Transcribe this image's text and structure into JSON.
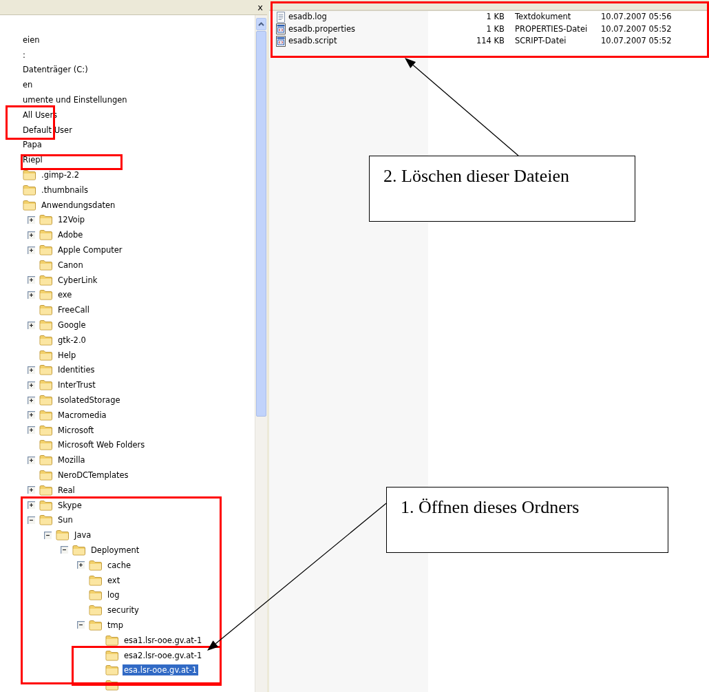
{
  "folder_pane": {
    "close": "x",
    "tree": [
      {
        "label": "eien",
        "kind": "clipped"
      },
      {
        "label": ":",
        "kind": "clipped"
      },
      {
        "label": "Datenträger (C:)",
        "kind": "clipped",
        "children": [
          {
            "label": "en",
            "kind": "clipped"
          },
          {
            "label": "umente und Einstellungen",
            "kind": "clipped",
            "children": [
              {
                "label": "All Users",
                "kind": "clipped"
              },
              {
                "label": "Default User",
                "kind": "clipped"
              },
              {
                "label": "Papa",
                "kind": "clipped"
              },
              {
                "label": "Riepl",
                "kind": "clipped",
                "children": [
                  {
                    "label": ".gimp-2.2",
                    "kind": "folder"
                  },
                  {
                    "label": ".thumbnails",
                    "kind": "folder"
                  },
                  {
                    "label": "Anwendungsdaten",
                    "kind": "folder",
                    "children": [
                      {
                        "label": "12Voip",
                        "kind": "folder",
                        "expanded": false
                      },
                      {
                        "label": "Adobe",
                        "kind": "folder",
                        "expanded": false
                      },
                      {
                        "label": "Apple Computer",
                        "kind": "folder",
                        "expanded": false
                      },
                      {
                        "label": "Canon",
                        "kind": "folder"
                      },
                      {
                        "label": "CyberLink",
                        "kind": "folder",
                        "expanded": false
                      },
                      {
                        "label": "exe",
                        "kind": "folder",
                        "expanded": false
                      },
                      {
                        "label": "FreeCall",
                        "kind": "folder"
                      },
                      {
                        "label": "Google",
                        "kind": "folder",
                        "expanded": false
                      },
                      {
                        "label": "gtk-2.0",
                        "kind": "folder"
                      },
                      {
                        "label": "Help",
                        "kind": "folder"
                      },
                      {
                        "label": "Identities",
                        "kind": "folder",
                        "expanded": false
                      },
                      {
                        "label": "InterTrust",
                        "kind": "folder",
                        "expanded": false
                      },
                      {
                        "label": "IsolatedStorage",
                        "kind": "folder",
                        "expanded": false
                      },
                      {
                        "label": "Macromedia",
                        "kind": "folder",
                        "expanded": false
                      },
                      {
                        "label": "Microsoft",
                        "kind": "folder",
                        "expanded": false
                      },
                      {
                        "label": "Microsoft Web Folders",
                        "kind": "folder"
                      },
                      {
                        "label": "Mozilla",
                        "kind": "folder",
                        "expanded": false
                      },
                      {
                        "label": "NeroDCTemplates",
                        "kind": "folder"
                      },
                      {
                        "label": "Real",
                        "kind": "folder",
                        "expanded": false
                      },
                      {
                        "label": "Skype",
                        "kind": "folder",
                        "expanded": false
                      },
                      {
                        "label": "Sun",
                        "kind": "folder",
                        "expanded": true,
                        "children": [
                          {
                            "label": "Java",
                            "kind": "folder",
                            "expanded": true,
                            "children": [
                              {
                                "label": "Deployment",
                                "kind": "folder",
                                "expanded": true,
                                "children": [
                                  {
                                    "label": "cache",
                                    "kind": "folder",
                                    "expanded": false
                                  },
                                  {
                                    "label": "ext",
                                    "kind": "folder"
                                  },
                                  {
                                    "label": "log",
                                    "kind": "folder"
                                  },
                                  {
                                    "label": "security",
                                    "kind": "folder"
                                  },
                                  {
                                    "label": "tmp",
                                    "kind": "folder",
                                    "expanded": true,
                                    "children": [
                                      {
                                        "label": "esa1.lsr-ooe.gv.at-1",
                                        "kind": "folder",
                                        "selected": false
                                      },
                                      {
                                        "label": "esa2.lsr-ooe.gv.at-1",
                                        "kind": "folder",
                                        "selected": false
                                      },
                                      {
                                        "label": "esa.lsr-ooe.gv.at-1",
                                        "kind": "folder",
                                        "selected": true
                                      },
                                      {
                                        "kind": "folder"
                                      }
                                    ]
                                  }
                                ]
                              }
                            ]
                          }
                        ]
                      }
                    ]
                  }
                ]
              }
            ]
          }
        ]
      }
    ]
  },
  "file_list": {
    "rows": [
      {
        "name": "esadb.log",
        "kind": "text",
        "size": "1 KB",
        "type": "Textdokument",
        "modified": "10.07.2007 05:56"
      },
      {
        "name": "esadb.properties",
        "kind": "script",
        "size": "1 KB",
        "type": "PROPERTIES-Datei",
        "modified": "10.07.2007 05:52"
      },
      {
        "name": "esadb.script",
        "kind": "script",
        "size": "114 KB",
        "type": "SCRIPT-Datei",
        "modified": "10.07.2007 05:52"
      }
    ]
  },
  "callouts": [
    "2. Löschen dieser Dateien",
    "1. Öffnen dieses Ordners"
  ]
}
